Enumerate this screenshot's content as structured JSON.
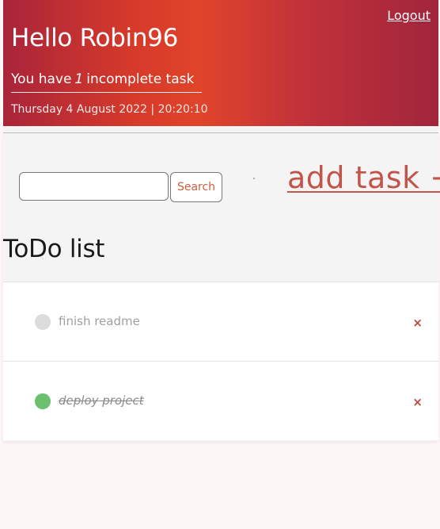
{
  "header": {
    "logout_label": "Logout",
    "greeting": "Hello Robin96",
    "summary_prefix": "You have",
    "summary_count": "1",
    "summary_suffix": "incomplete task",
    "datetime": "Thursday 4 August 2022 | 20:20:10",
    "gradient_colors": [
      "#a9243a",
      "#e0442a",
      "#a1253c"
    ]
  },
  "toolbar": {
    "search_value": "",
    "search_placeholder": "",
    "search_button_label": "Search",
    "add_task_label": "add task +",
    "accent_color": "#c2554a"
  },
  "list": {
    "title": "ToDo list",
    "tasks": [
      {
        "text": "finish readme",
        "completed": false,
        "status_color": "#dcdcdc",
        "delete_icon": "close-icon",
        "delete_label": "×"
      },
      {
        "text": "deploy project",
        "completed": true,
        "status_color": "#6cc070",
        "delete_icon": "close-icon",
        "delete_label": "×"
      }
    ]
  }
}
